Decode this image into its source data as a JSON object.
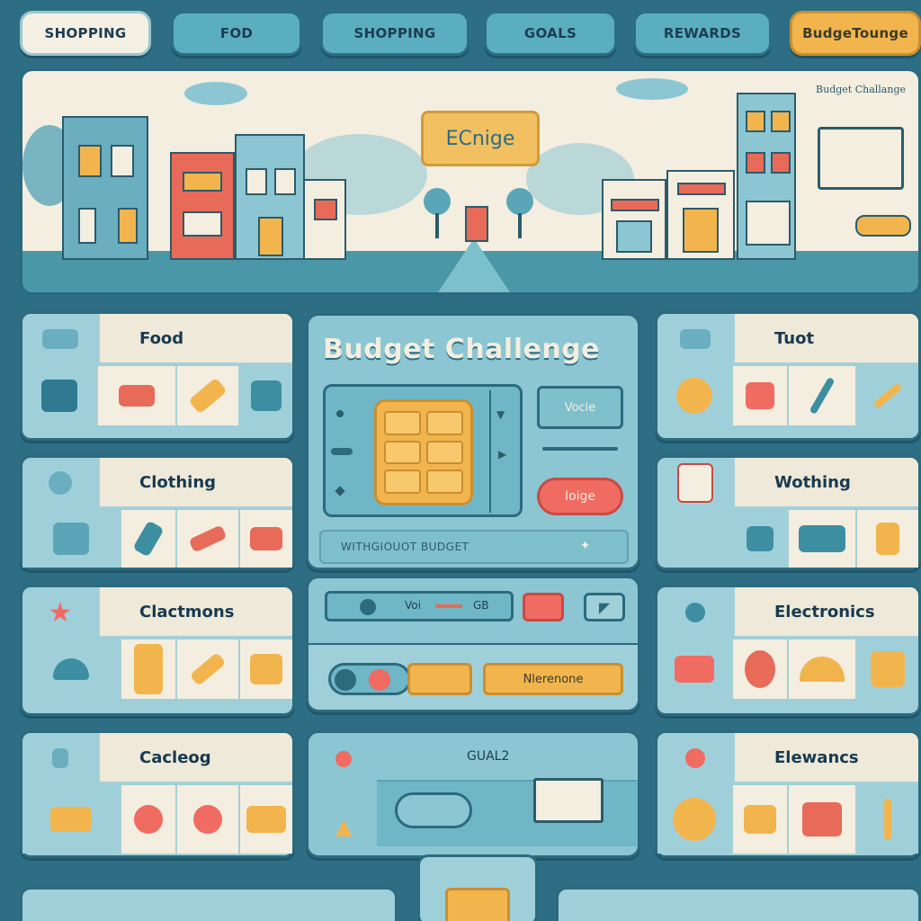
{
  "tabs": [
    {
      "label": "SHOPPING"
    },
    {
      "label": "FOD"
    },
    {
      "label": "SHOPPING"
    },
    {
      "label": "GOALS"
    },
    {
      "label": "REWARDS"
    },
    {
      "label": "BudgeTounge"
    }
  ],
  "banner": {
    "button_label": "ECnige",
    "sign_text": "Budget Challange"
  },
  "categories_left": [
    {
      "title": "Food"
    },
    {
      "title": "Clothing"
    },
    {
      "title": "Clactmons"
    },
    {
      "title": "Cacleog"
    }
  ],
  "categories_right": [
    {
      "title": "Tuot"
    },
    {
      "title": "Wothing"
    },
    {
      "title": "Electronics"
    },
    {
      "title": "Elewancs"
    }
  ],
  "center": {
    "title": "Budget Challenge",
    "voice_label": "Vocie",
    "lounge_label": "Ioige",
    "budget_bar_text": "WITHGIOUOT BUDGET"
  },
  "controls": {
    "voice_label": "Voi",
    "value_label": "GB",
    "action_label": "Nlerenone"
  },
  "goal": {
    "label": "GUAL2"
  },
  "colors": {
    "background": "#2e6e85",
    "accent_yellow": "#f2b54e",
    "accent_red": "#f06b62",
    "panel_blue": "#9fd0da",
    "cream": "#f3eedf"
  }
}
